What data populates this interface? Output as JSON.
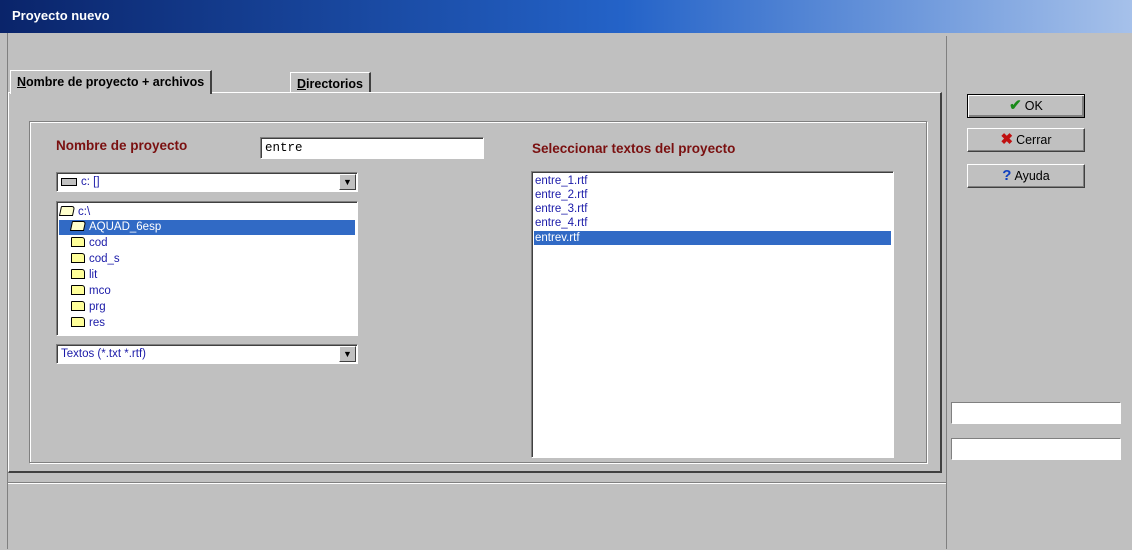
{
  "window": {
    "title": "Proyecto nuevo"
  },
  "tabs": [
    {
      "label_u": "N",
      "label_rest": "ombre de proyecto + archivos"
    },
    {
      "label_u": "D",
      "label_rest": "irectorios"
    }
  ],
  "project": {
    "name_label": "Nombre de proyecto",
    "name_value": "entre",
    "drive": "c: []",
    "dirs": [
      "c:\\",
      "AQUAD_6esp",
      "cod",
      "cod_s",
      "lit",
      "mco",
      "prg",
      "res"
    ],
    "filter": "Textos (*.txt *.rtf)"
  },
  "texts": {
    "label": "Seleccionar textos del proyecto",
    "files": [
      "entre_1.rtf",
      "entre_2.rtf",
      "entre_3.rtf",
      "entre_4.rtf",
      "entrev.rtf"
    ]
  },
  "buttons": {
    "ok": "OK",
    "close": "Cerrar",
    "help": "Ayuda"
  },
  "colors": {
    "ok_check": "#1a8a1a",
    "close_x": "#c01010",
    "help_q": "#1040c0",
    "selection": "#316ac5"
  }
}
